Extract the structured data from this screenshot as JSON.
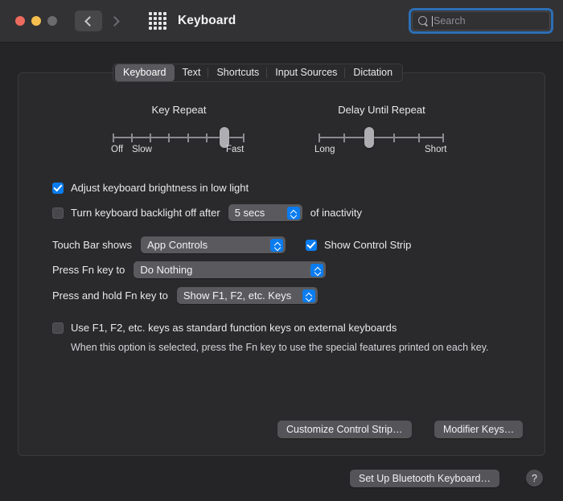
{
  "window": {
    "title": "Keyboard",
    "traffic_lights": [
      "close",
      "minimize",
      "zoom"
    ],
    "nav": {
      "back_icon": "chevron-left-icon",
      "forward_icon": "chevron-right-icon"
    },
    "show_all_icon": "grid-apps-icon"
  },
  "search": {
    "placeholder": "Search",
    "value": "",
    "icon": "search-icon",
    "focused": true
  },
  "tabs": [
    {
      "label": "Keyboard",
      "active": true
    },
    {
      "label": "Text",
      "active": false
    },
    {
      "label": "Shortcuts",
      "active": false
    },
    {
      "label": "Input Sources",
      "active": false
    },
    {
      "label": "Dictation",
      "active": false
    }
  ],
  "sliders": {
    "key_repeat": {
      "title": "Key Repeat",
      "min_label": "Off",
      "second_label": "Slow",
      "max_label": "Fast",
      "ticks": 8,
      "value_index": 7
    },
    "delay_until_repeat": {
      "title": "Delay Until Repeat",
      "min_label": "Long",
      "max_label": "Short",
      "ticks": 6,
      "value_index": 3
    }
  },
  "options": {
    "adjust_brightness": {
      "label": "Adjust keyboard brightness in low light",
      "checked": true
    },
    "backlight_off": {
      "label": "Turn keyboard backlight off after",
      "checked": false,
      "value": "5 secs",
      "suffix": "of inactivity"
    },
    "touch_bar_shows": {
      "label": "Touch Bar shows",
      "value": "App Controls"
    },
    "show_control_strip": {
      "label": "Show Control Strip",
      "checked": true
    },
    "press_fn": {
      "label": "Press Fn key to",
      "value": "Do Nothing"
    },
    "press_hold_fn": {
      "label": "Press and hold Fn key to",
      "value": "Show F1, F2, etc. Keys"
    },
    "use_fkeys": {
      "label": "Use F1, F2, etc. keys as standard function keys on external keyboards",
      "checked": false,
      "description": "When this option is selected, press the Fn key to use the special features printed on each key."
    }
  },
  "buttons": {
    "customize_control_strip": "Customize Control Strip…",
    "modifier_keys": "Modifier Keys…",
    "setup_bluetooth_keyboard": "Set Up Bluetooth Keyboard…",
    "help": "?"
  },
  "colors": {
    "accent": "#0a7cf0",
    "focus_ring": "#2d6fb5",
    "panel": "#2a2a2c",
    "window": "#252527"
  }
}
